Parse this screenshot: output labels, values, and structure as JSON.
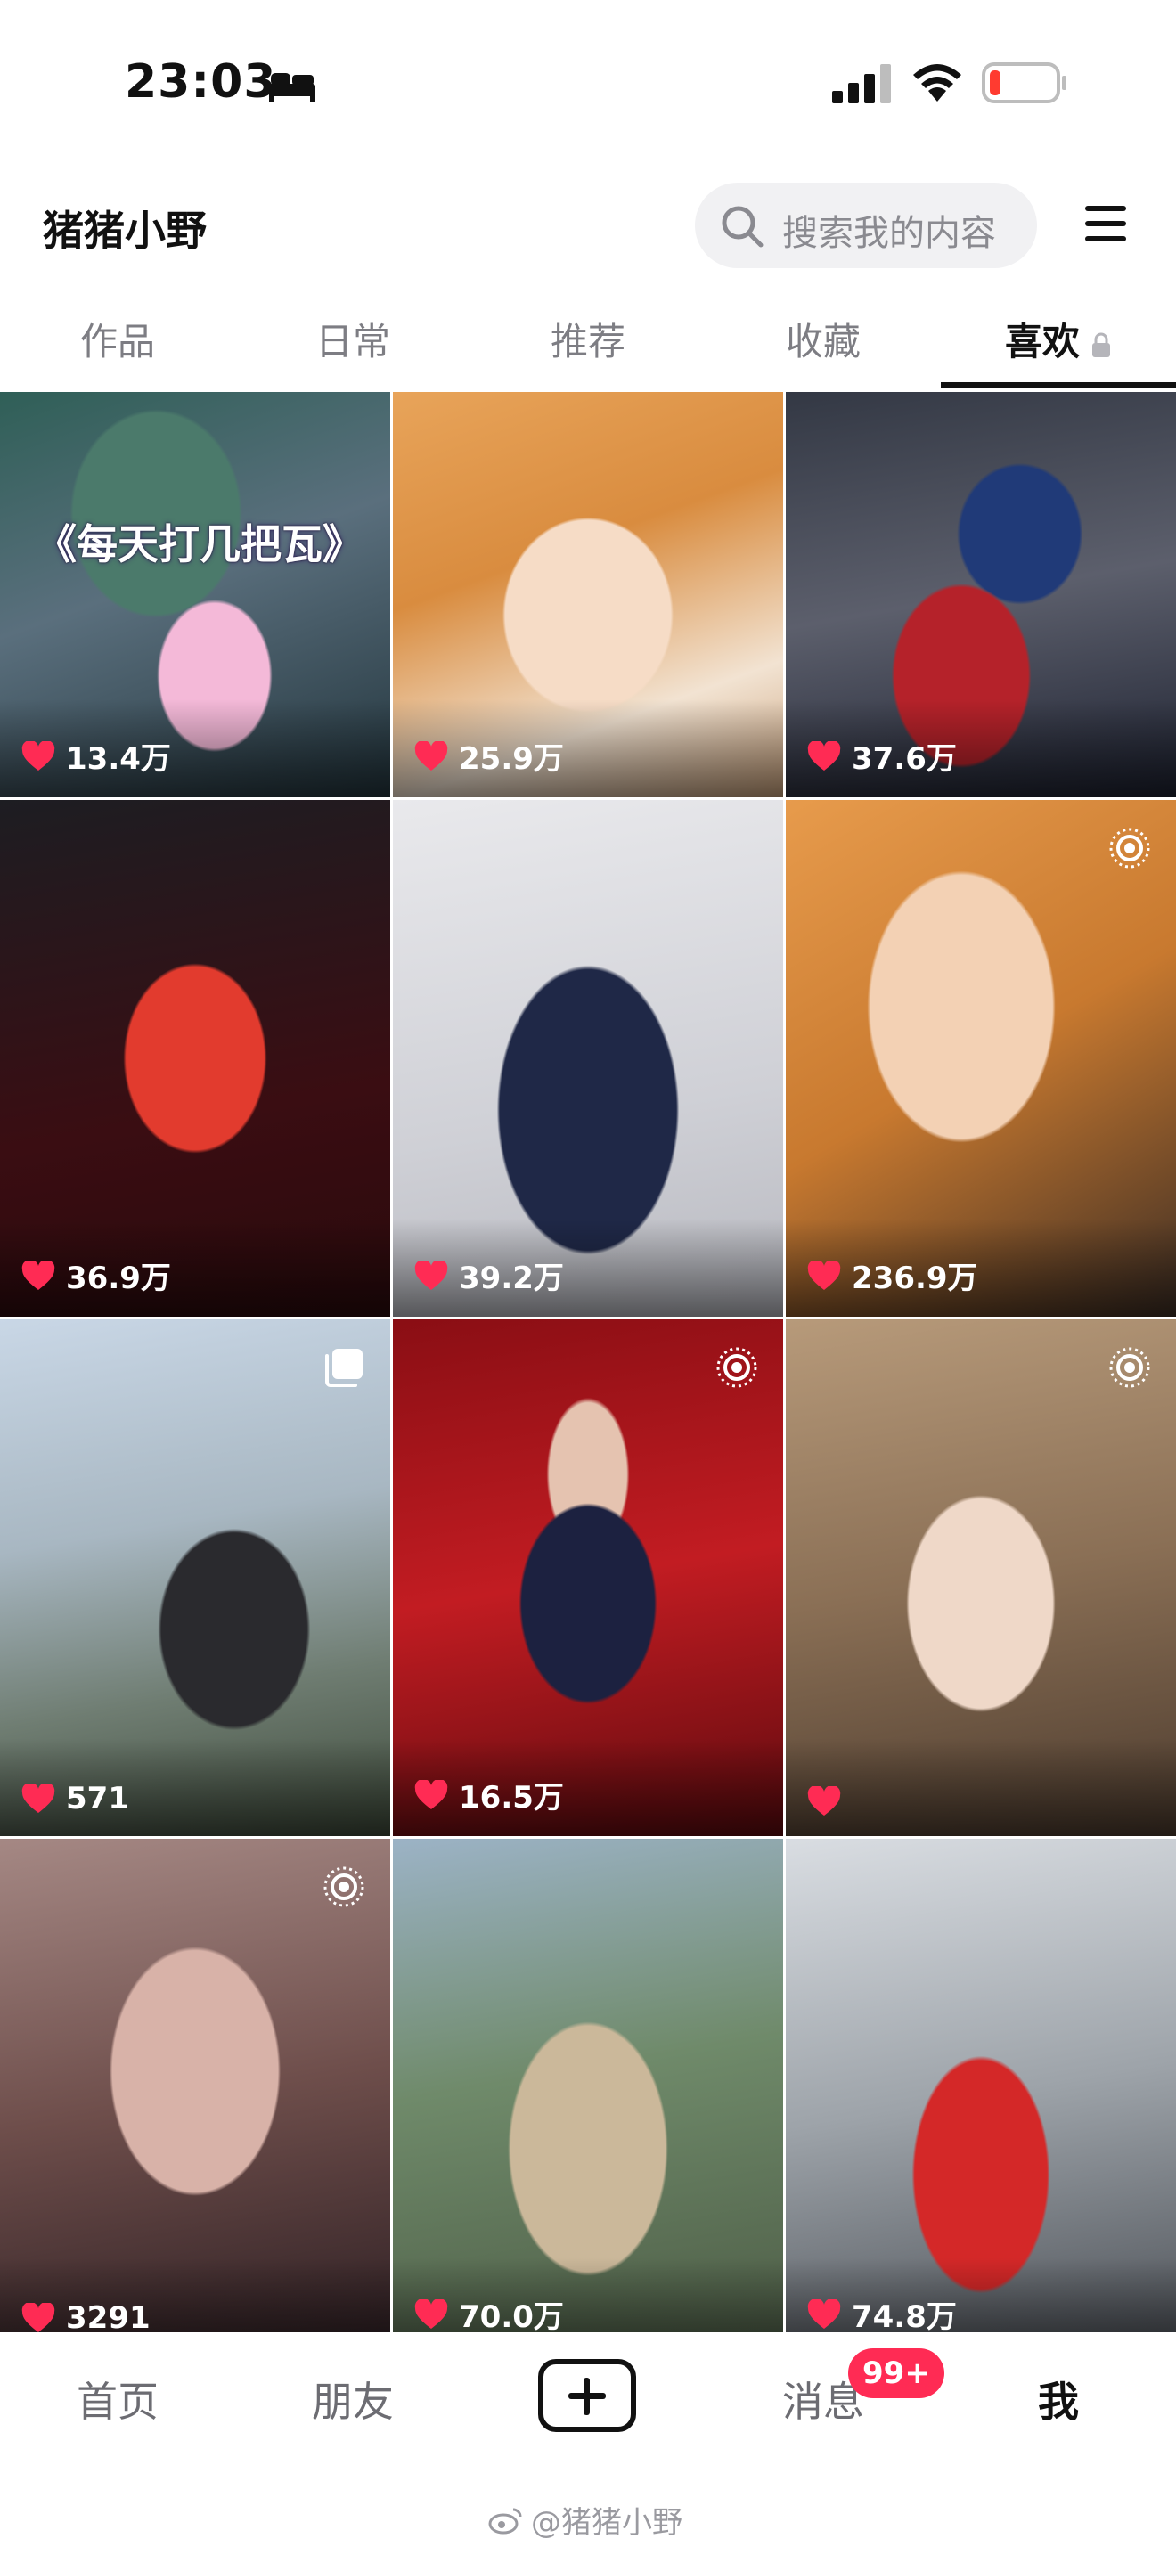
{
  "status_bar": {
    "time": "23:03",
    "icons": [
      "bed-icon",
      "signal-icon",
      "wifi-icon",
      "battery-low-icon"
    ]
  },
  "header": {
    "username": "猪猪小野",
    "search_placeholder": "搜索我的内容",
    "menu_icon": "menu-icon"
  },
  "tabs": [
    {
      "label": "作品"
    },
    {
      "label": "日常"
    },
    {
      "label": "推荐"
    },
    {
      "label": "收藏"
    },
    {
      "label": "喜欢",
      "active": true,
      "locked": true
    }
  ],
  "grid": {
    "tiles": [
      {
        "likes": "13.4万",
        "overlay_text": "《每天打几把瓦》"
      },
      {
        "likes": "25.9万"
      },
      {
        "likes": "37.6万"
      },
      {
        "likes": "36.9万"
      },
      {
        "likes": "39.2万"
      },
      {
        "likes": "236.9万",
        "badge": "live-photo-icon"
      },
      {
        "likes": "571",
        "badge": "multi-image-icon"
      },
      {
        "likes": "16.5万",
        "badge": "live-photo-icon"
      },
      {
        "likes": "",
        "badge": "live-photo-icon"
      },
      {
        "likes": "3291",
        "badge": "live-photo-icon"
      },
      {
        "likes": "70.0万"
      },
      {
        "likes": "74.8万"
      }
    ]
  },
  "bottom_nav": {
    "items": [
      {
        "label": "首页"
      },
      {
        "label": "朋友"
      },
      {
        "label": "",
        "icon": "add-icon"
      },
      {
        "label": "消息",
        "badge": "99+"
      },
      {
        "label": "我",
        "active": true
      }
    ],
    "watermark": "@猪猪小野"
  },
  "colors": {
    "accent": "#ff2b54",
    "text_primary": "#111111",
    "text_secondary": "#7d7d83",
    "search_bg": "#f1f1f3"
  }
}
